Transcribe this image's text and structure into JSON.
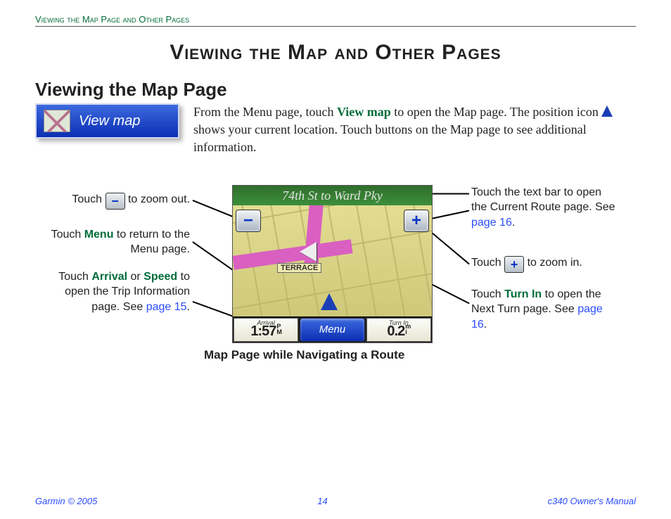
{
  "header": "Viewing the Map Page and Other Pages",
  "main_title": "Viewing the Map and Other Pages",
  "section_title": "Viewing the Map Page",
  "view_map_button": "View map",
  "intro": {
    "part1": "From the Menu page, touch ",
    "kw1": "View map",
    "part2": " to open the Map page. The position icon ",
    "part3": " shows your current location. Touch buttons on the Map page to see additional information."
  },
  "callouts": {
    "zoom_out_pre": "Touch ",
    "zoom_out_post": " to zoom out.",
    "menu_pre": "Touch ",
    "menu_kw": "Menu",
    "menu_post": " to return to the Menu page.",
    "arrival_pre": "Touch ",
    "arrival_kw": "Arrival",
    "arrival_mid": " or ",
    "speed_kw": "Speed",
    "arrival_post": " to open the Trip Information page. See ",
    "arrival_link": "page 15",
    "textbar_pre": "Touch the text bar to open the Current Route page. See ",
    "textbar_link": "page 16",
    "zoom_in_pre": "Touch ",
    "zoom_in_post": " to zoom in.",
    "turnin_pre": "Touch ",
    "turnin_kw": "Turn In",
    "turnin_post": " to open the Next Turn page. See ",
    "turnin_link": "page 16",
    "dot": "."
  },
  "gps": {
    "title": "74th St to Ward Pky",
    "terrace": "TERRACE",
    "arrival_label": "Arrival",
    "arrival_value": "1:57",
    "arrival_unit1": "P",
    "arrival_unit2": "M",
    "menu": "Menu",
    "turnin_label": "Turn In",
    "turnin_value": "0.2",
    "turnin_unit1": "m",
    "turnin_unit2": "i",
    "minus": "−",
    "plus": "+"
  },
  "caption": "Map Page while Navigating a Route",
  "footer": {
    "left": "Garmin © 2005",
    "center": "14",
    "right": "c340 Owner's Manual"
  }
}
